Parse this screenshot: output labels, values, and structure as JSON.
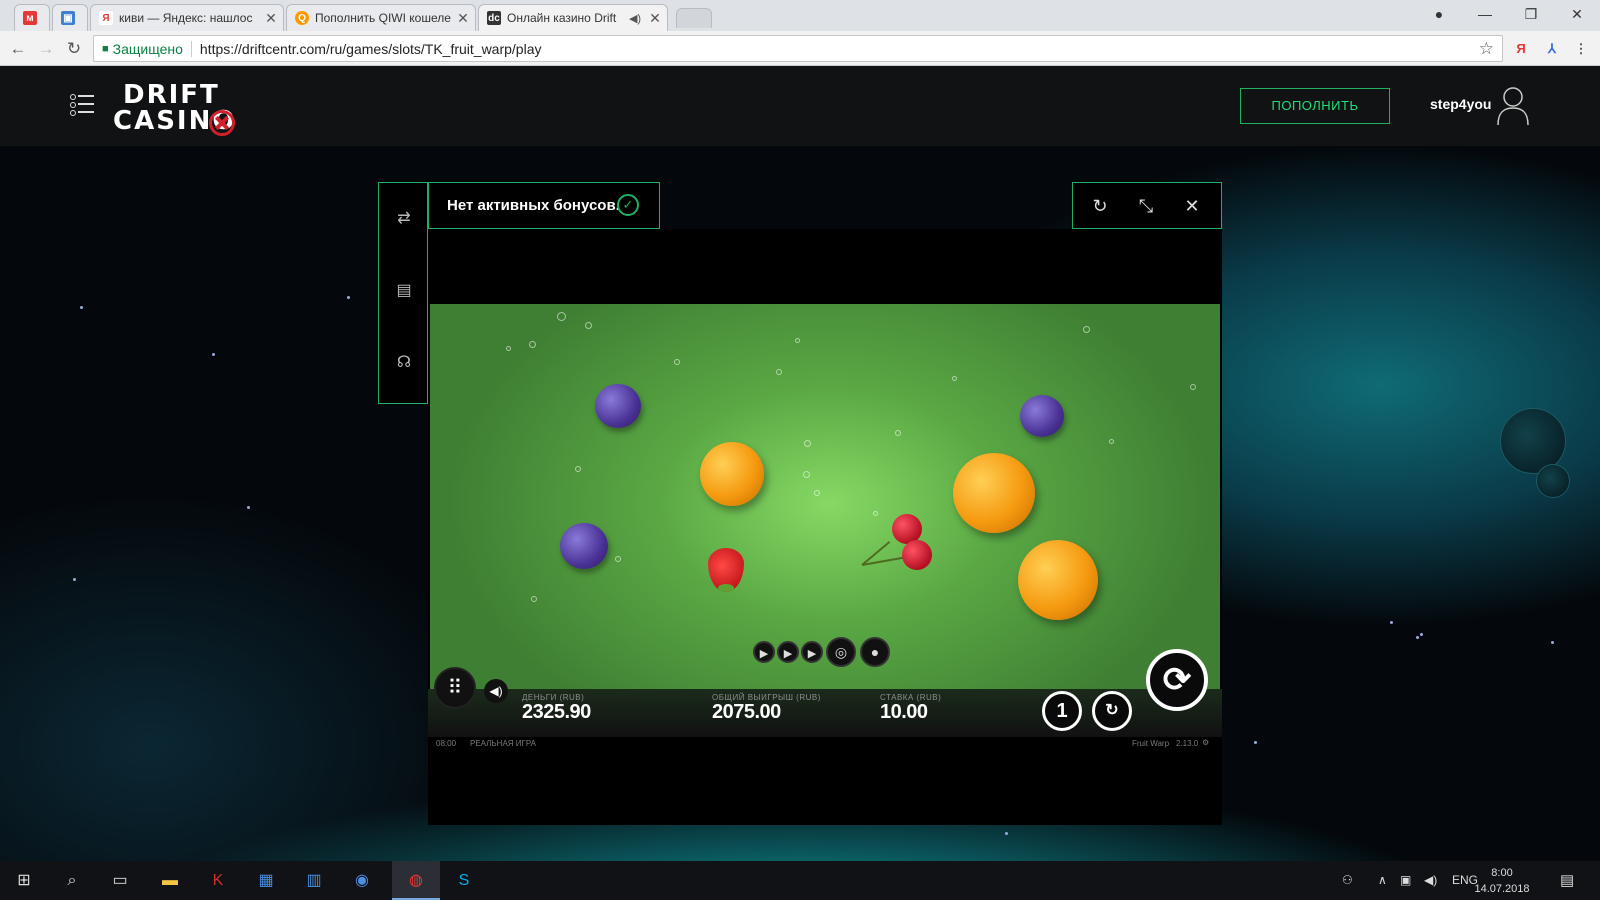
{
  "browser": {
    "tabs": [
      {
        "label": "",
        "favicon": "mail-icon",
        "active": false
      },
      {
        "label": "",
        "favicon": "doc-icon",
        "active": false
      },
      {
        "label": "киви — Яндекс: нашлос",
        "favicon": "yandex-icon",
        "active": false
      },
      {
        "label": "Пополнить QIWI кошеле",
        "favicon": "qiwi-icon",
        "active": false
      },
      {
        "label": "Онлайн казино Drift",
        "favicon": "drift-icon",
        "active": true
      }
    ],
    "secure_label": "Защищено",
    "url": "https://driftcentr.com/ru/games/slots/TK_fruit_warp/play",
    "yandex_ext": "Я"
  },
  "site": {
    "logo_line1": "DRIFT",
    "logo_line2": "CASINO",
    "deposit_label": "ПОПОЛНИТЬ",
    "username": "step4you"
  },
  "game": {
    "bonus_text": "Нет активных бонусов.",
    "hud": {
      "money_label": "ДЕНЬГИ (RUB)",
      "money_value": "2325.90",
      "win_label": "ОБЩИЙ ВЫИГРЫШ (RUB)",
      "win_value": "2075.00",
      "bet_label": "СТАВКА (RUB)",
      "bet_value": "10.00"
    },
    "footer": {
      "time": "08:00",
      "mode": "РЕАЛЬНАЯ ИГРА",
      "game_name": "Fruit Warp",
      "version": "2.13.0"
    },
    "bet_button_label": "1",
    "colors": {
      "frame_accent": "#1fb062",
      "field_green": "#5aa844"
    }
  },
  "taskbar": {
    "lang": "ENG",
    "time": "8:00",
    "date": "14.07.2018"
  }
}
